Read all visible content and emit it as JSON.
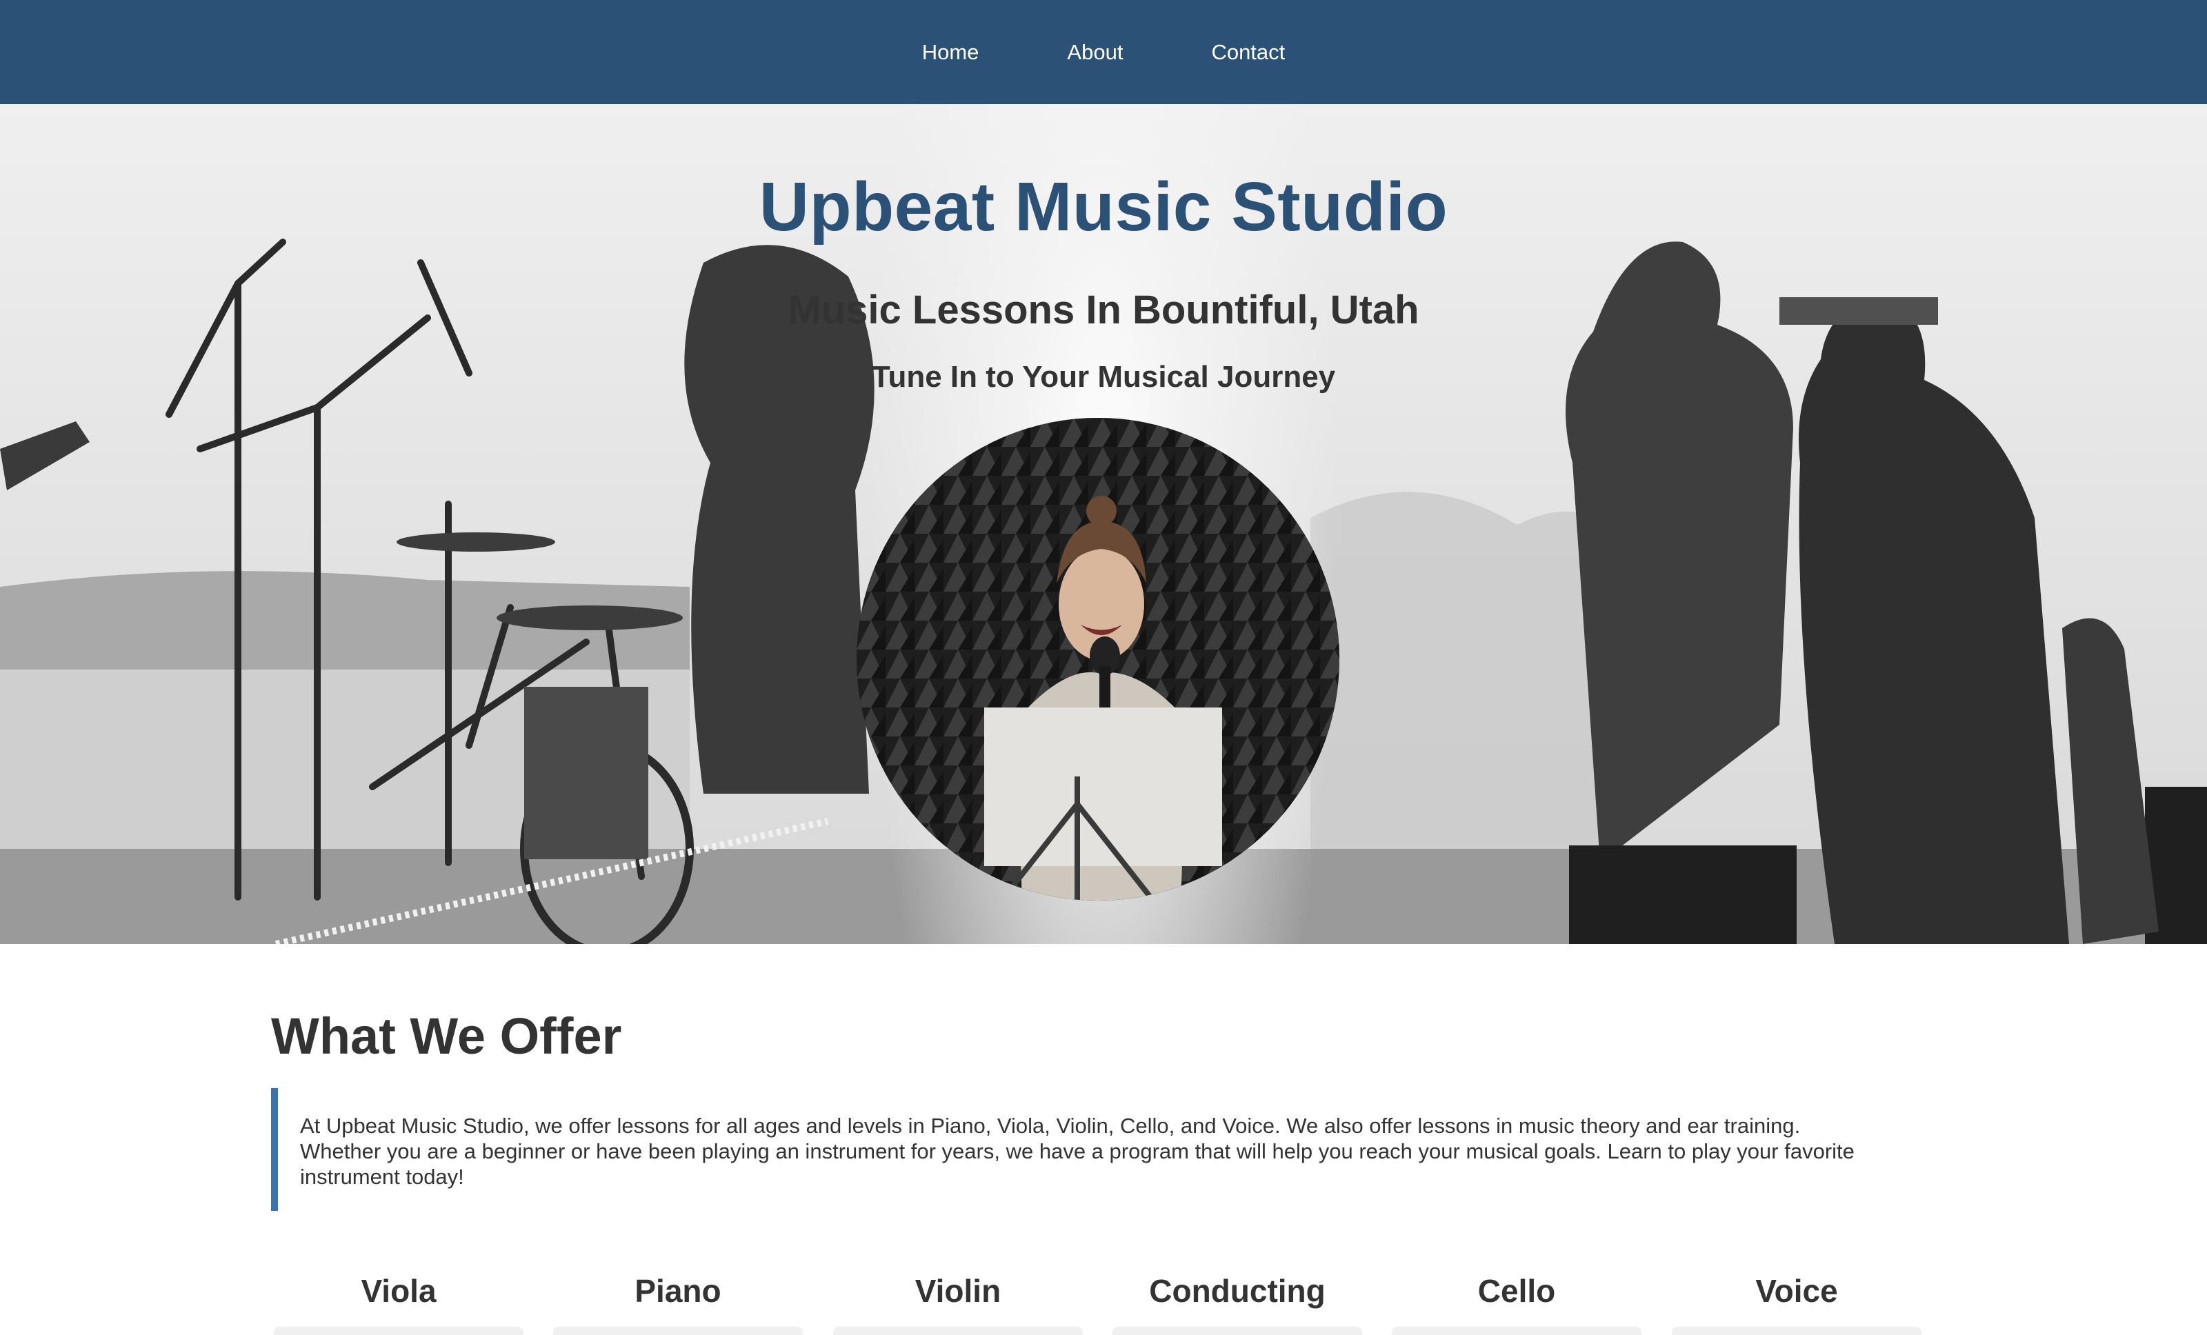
{
  "nav": {
    "items": [
      {
        "label": "Home"
      },
      {
        "label": "About"
      },
      {
        "label": "Contact"
      }
    ]
  },
  "hero": {
    "title": "Upbeat Music Studio",
    "subtitle": "Music Lessons In Bountiful, Utah",
    "tagline": "Tune In to Your Musical Journey",
    "background_image": "grayscale photo of band performing outdoors on stage",
    "circle_image": "girl singing into microphone in front of acoustic foam"
  },
  "offer": {
    "heading": "What We Offer",
    "description": "At Upbeat Music Studio, we offer lessons for all ages and levels in Piano, Viola, Violin, Cello, and Voice. We also offer lessons in music theory and ear training. Whether you are a beginner or have been playing an instrument for years, we have a program that will help you reach your musical goals. Learn to play your favorite instrument today!",
    "instruments": [
      {
        "label": "Viola"
      },
      {
        "label": "Piano"
      },
      {
        "label": "Violin"
      },
      {
        "label": "Conducting"
      },
      {
        "label": "Cello"
      },
      {
        "label": "Voice"
      }
    ]
  },
  "colors": {
    "nav_bg": "#2b5176",
    "title": "#2b5176",
    "text": "#333333",
    "quote_border": "#3a73b0"
  }
}
